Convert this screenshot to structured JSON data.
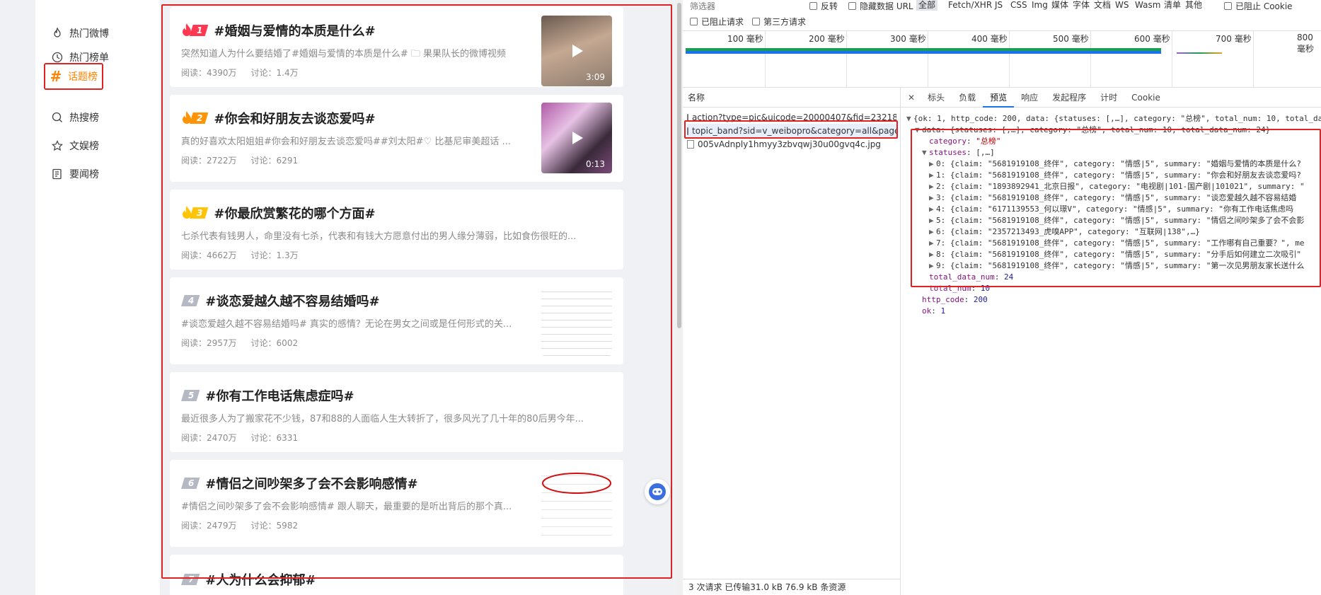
{
  "nav": {
    "items": [
      {
        "label": "热门微博",
        "icon": "flame-icon"
      },
      {
        "label": "热门榜单",
        "icon": "clock-icon"
      },
      {
        "label": "话题榜",
        "icon": "hashtag-icon",
        "active": true
      },
      {
        "label": "热搜榜",
        "icon": "search-icon"
      },
      {
        "label": "文娱榜",
        "icon": "star-icon"
      },
      {
        "label": "要闻榜",
        "icon": "news-icon"
      }
    ]
  },
  "topics": [
    {
      "rank": "1",
      "title": "#婚姻与爱情的本质是什么#",
      "summary": "突然知道人为什么要结婚了#婚姻与爱情的本质是什么# 🗀 果果队长的微博视频",
      "read": "阅读：4390万",
      "discuss": "讨论：1.4万",
      "duration": "3:09"
    },
    {
      "rank": "2",
      "title": "#你会和好朋友去谈恋爱吗#",
      "summary": "真的好喜欢太阳姐姐#你会和好朋友去谈恋爱吗##刘太阳#♡ 比基尼审美超话 ...",
      "read": "阅读：2722万",
      "discuss": "讨论：6291",
      "duration": "0:13"
    },
    {
      "rank": "3",
      "title": "#你最欣赏繁花的哪个方面#",
      "summary": "七杀代表有钱男人，命里没有七杀，代表和有钱大方愿意付出的男人缘分薄弱，比如食伤很旺的...",
      "read": "阅读：4662万",
      "discuss": "讨论：1.3万"
    },
    {
      "rank": "4",
      "title": "#谈恋爱越久越不容易结婚吗#",
      "summary": "#谈恋爱越久越不容易结婚吗# 真实的感情？无论在男女之间或是任何形式的关...",
      "read": "阅读：2957万",
      "discuss": "讨论：6002"
    },
    {
      "rank": "5",
      "title": "#你有工作电话焦虑症吗#",
      "summary": "最近很多人为了搬家花不少钱，87和88的人面临人生大转折了，很多风光了几十年的80后男今年...",
      "read": "阅读：2470万",
      "discuss": "讨论：6331"
    },
    {
      "rank": "6",
      "title": "#情侣之间吵架多了会不会影响感情#",
      "summary": "#情侣之间吵架多了会不会影响感情# 跟人聊天，最重要的是听出背后的那个真...",
      "read": "阅读：2479万",
      "discuss": "讨论：5982"
    },
    {
      "rank": "7",
      "title": "#人为什么会抑郁#"
    }
  ],
  "devtools": {
    "filter_label": "筛选器",
    "invert": "反转",
    "hide_data_url": "隐藏数据 URL",
    "type_filters": [
      "全部",
      "Fetch/XHR",
      "JS",
      "CSS",
      "Img",
      "媒体",
      "字体",
      "文档",
      "WS",
      "Wasm",
      "清单",
      "其他"
    ],
    "blocked_cookies": "已阻止 Cookie",
    "blocked_requests": "已阻止请求",
    "third_party": "第三方请求",
    "ticks": [
      "100 毫秒",
      "200 毫秒",
      "300 毫秒",
      "400 毫秒",
      "500 毫秒",
      "600 毫秒",
      "700 毫秒",
      "800 毫秒"
    ],
    "name_header": "名称",
    "requests": [
      "action?type=pic&uicode=20000407&fid=232188...",
      "topic_band?sid=v_weibopro&category=all&page...",
      "005vAdnply1hmyy3zbvqwj30u00gvq4c.jpg"
    ],
    "status": "3 次请求  已传输31.0 kB  76.9 kB 条资源",
    "tabs": [
      "标头",
      "负载",
      "预览",
      "响应",
      "发起程序",
      "计时",
      "Cookie"
    ],
    "json": {
      "root": "{ok: 1, http_code: 200, data: {statuses: [,…], category: \"总榜\", total_num: 10, total_data_num: 24}",
      "data_line": "data: {statuses: [,…], category: \"总榜\", total_num: 10, total_data_num: 24}",
      "category_key": "category",
      "category_val": "\"总榜\"",
      "statuses_key": "statuses",
      "statuses_val": "[,…]",
      "rows": [
        "0: {claim: \"5681919108_终伴\", category: \"情感|5\", summary: \"婚姻与爱情的本质是什么?",
        "1: {claim: \"5681919108_终伴\", category: \"情感|5\", summary: \"你会和好朋友去谈恋爱吗?",
        "2: {claim: \"1893892941_北京日报\", category: \"电视剧|101-国产剧|101021\", summary: \"",
        "3: {claim: \"5681919108_终伴\", category: \"情感|5\", summary: \"谈恋爱越久越不容易结婚",
        "4: {claim: \"6171139553_何以璟V\", category: \"情感|5\", summary: \"你有工作电话焦虑吗",
        "5: {claim: \"5681919108_终伴\", category: \"情感|5\", summary: \"情侣之间吵架多了会不会影",
        "6: {claim: \"2357213493_虎嗅APP\", category: \"互联网|138\",…}",
        "7: {claim: \"5681919108_终伴\", category: \"情感|5\", summary: \"工作哪有自己重要？\", me",
        "8: {claim: \"5681919108_终伴\", category: \"情感|5\", summary: \"分手后如何建立二次吸引\"",
        "9: {claim: \"5681919108_终伴\", category: \"情感|5\", summary: \"第一次见男朋友家长送什么"
      ],
      "total_data_num_key": "total_data_num",
      "total_data_num_val": "24",
      "total_num_key": "total_num",
      "total_num_val": "10",
      "http_code_key": "http_code",
      "http_code_val": "200",
      "ok_key": "ok",
      "ok_val": "1"
    }
  },
  "colors": {
    "accent": "#ff8200",
    "highlight_box": "#e02222",
    "rank_hot": "#ff3852",
    "rank_mid": "#ff9406",
    "rank_low": "#ffc307",
    "rank_gray": "#b4b9c4"
  }
}
